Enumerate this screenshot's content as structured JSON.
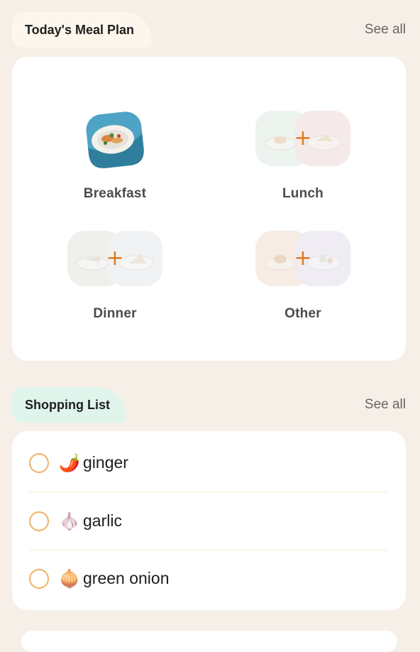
{
  "meal_plan": {
    "title": "Today's Meal Plan",
    "see_all": "See all",
    "meals": [
      {
        "label": "Breakfast",
        "state": "filled"
      },
      {
        "label": "Lunch",
        "state": "empty",
        "add_glyph": "+"
      },
      {
        "label": "Dinner",
        "state": "empty",
        "add_glyph": "+"
      },
      {
        "label": "Other",
        "state": "empty",
        "add_glyph": "+"
      }
    ]
  },
  "shopping_list": {
    "title": "Shopping List",
    "see_all": "See all",
    "items": [
      {
        "emoji": "🌶️",
        "icon": "chili-pepper-icon",
        "name": "ginger",
        "checked": false
      },
      {
        "emoji": "🧄",
        "icon": "garlic-icon",
        "name": "garlic",
        "checked": false
      },
      {
        "emoji": "🧅",
        "icon": "onion-icon",
        "name": "green onion",
        "checked": false
      }
    ]
  },
  "colors": {
    "accent": "#e07a1f",
    "checkbox": "#f2b06a",
    "background": "#f5efe7"
  }
}
